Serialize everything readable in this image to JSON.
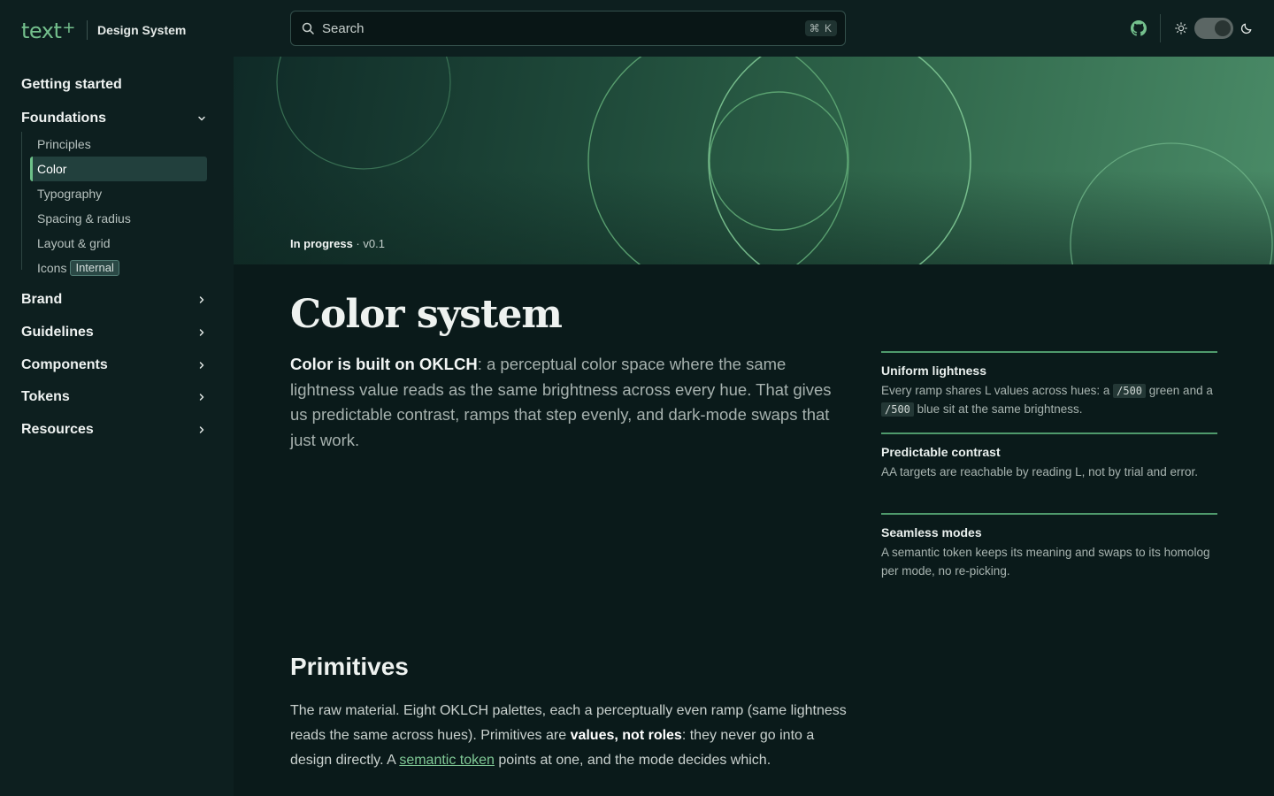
{
  "header": {
    "logo_text": "text",
    "logo_sup": "+",
    "product_name": "Design System",
    "search_placeholder": "Search",
    "search_shortcut": "⌘ K"
  },
  "sidebar": {
    "items": [
      {
        "label": "Getting started"
      },
      {
        "label": "Foundations",
        "expanded": true
      },
      {
        "label": "Brand"
      },
      {
        "label": "Guidelines"
      },
      {
        "label": "Components"
      },
      {
        "label": "Tokens"
      },
      {
        "label": "Resources"
      }
    ],
    "foundations_children": [
      {
        "label": "Principles"
      },
      {
        "label": "Color",
        "active": true
      },
      {
        "label": "Typography"
      },
      {
        "label": "Spacing & radius"
      },
      {
        "label": "Layout & grid"
      },
      {
        "label": "Icons",
        "badge": "Internal"
      }
    ]
  },
  "hero": {
    "status": "In progress",
    "version": " · v0.1"
  },
  "main": {
    "title": "Color system",
    "lead_bold": "Color is built on OKLCH",
    "lead_rest": ": a perceptual color space where the same lightness value reads as the same brightness across every hue. That gives us predictable contrast, ramps that step evenly, and dark-mode swaps that just work.",
    "features": [
      {
        "title": "Uniform lightness",
        "text_1": "Every ramp shares L values across hues: a ",
        "code_1": "/500",
        "text_2": " green and a ",
        "code_2": "/500",
        "text_3": " blue sit at the same brightness."
      },
      {
        "title": "Predictable contrast",
        "text": "AA targets are reachable by reading L, not by trial and error."
      },
      {
        "title": "Seamless modes",
        "text": "A semantic token keeps its meaning and swaps to its homolog per mode, no re-picking."
      }
    ],
    "primitives": {
      "title": "Primitives",
      "text_1": "The raw material. Eight OKLCH palettes, each a perceptually even ramp (same lightness reads the same across hues). Primitives are ",
      "text_bold": "values, not roles",
      "text_2": ": they never go into a design directly. A ",
      "link": "semantic token",
      "text_3": " points at one, and the mode decides which."
    }
  },
  "colors": {
    "accent": "#74c08d",
    "background": "#0a1a1a",
    "sidebar": "#0d1f1f"
  }
}
